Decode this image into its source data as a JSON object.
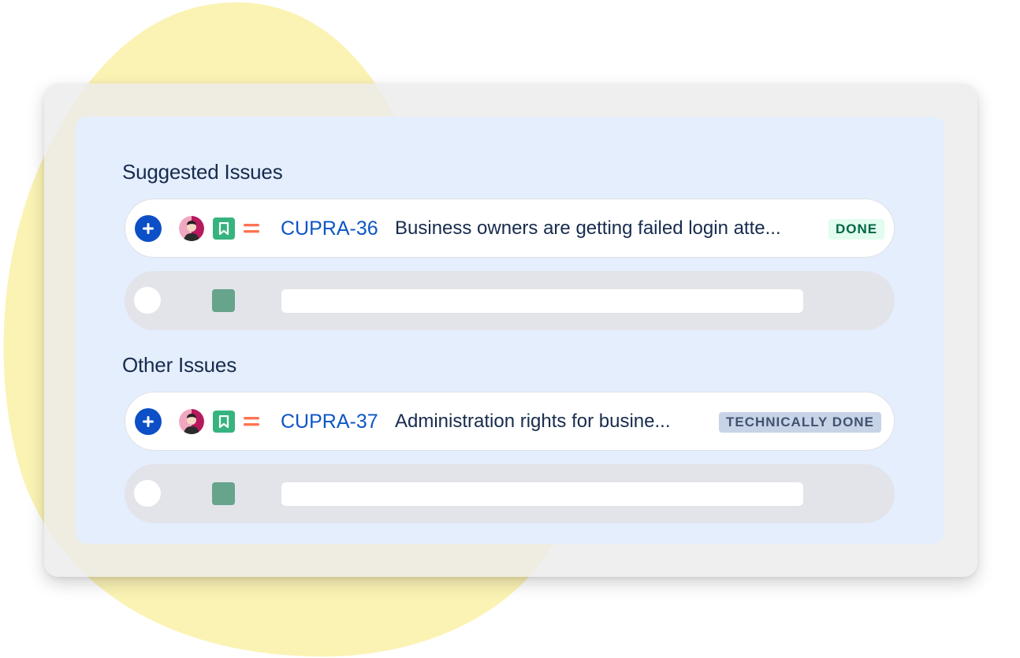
{
  "colors": {
    "blob": "#fbf3b4",
    "panel": "#e4eefd",
    "link": "#0c56c5",
    "story": "#36b37e",
    "priority": "#ff7452"
  },
  "sections": [
    {
      "heading": "Suggested Issues",
      "issue": {
        "key": "CUPRA-36",
        "summary": "Business owners are getting failed login atte...",
        "status": "DONE",
        "icons": [
          "add-icon",
          "avatar",
          "story-icon",
          "priority-medium-icon"
        ]
      }
    },
    {
      "heading": "Other Issues",
      "issue": {
        "key": "CUPRA-37",
        "summary": "Administration rights for busine...",
        "status": "TECHNICALLY DONE",
        "icons": [
          "add-icon",
          "avatar",
          "story-icon",
          "priority-medium-icon"
        ]
      }
    }
  ]
}
